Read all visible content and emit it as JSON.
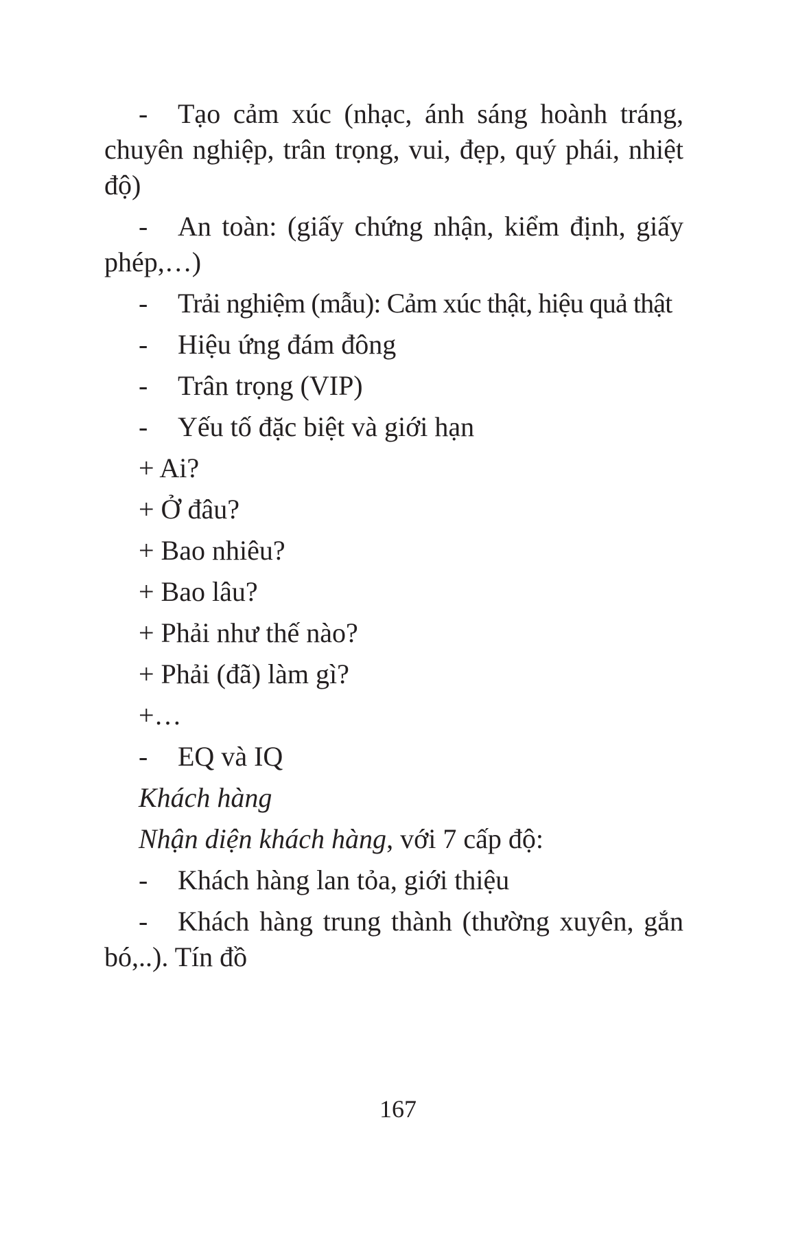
{
  "items": [
    {
      "type": "dash",
      "text": "Tạo cảm xúc (nhạc, ánh sáng hoành tráng, chuyên nghiệp, trân trọng, vui, đẹp, quý phái, nhiệt độ)"
    },
    {
      "type": "dash",
      "text": "An toàn: (giấy chứng nhận, kiểm định, giấy phép,…)"
    },
    {
      "type": "dash",
      "text": "Trải nghiệm (mẫu): Cảm xúc thật, hiệu quả thật"
    },
    {
      "type": "dash",
      "text": "Hiệu ứng đám đông"
    },
    {
      "type": "dash",
      "text": "Trân trọng (VIP)"
    },
    {
      "type": "dash",
      "text": "Yếu tố đặc biệt và giới hạn"
    },
    {
      "type": "plus",
      "text": "+ Ai?"
    },
    {
      "type": "plus",
      "text": "+ Ở đâu?"
    },
    {
      "type": "plus",
      "text": "+ Bao nhiêu?"
    },
    {
      "type": "plus",
      "text": "+ Bao lâu?"
    },
    {
      "type": "plus",
      "text": "+ Phải như thế nào?"
    },
    {
      "type": "plus",
      "text": "+ Phải (đã) làm gì?"
    },
    {
      "type": "plus",
      "text": "+…"
    },
    {
      "type": "dash",
      "text": "EQ và IQ"
    },
    {
      "type": "heading",
      "text": "Khách hàng"
    },
    {
      "type": "mixed",
      "italic": "Nhận diện khách hàng",
      "rest": ", với 7 cấp độ:"
    },
    {
      "type": "dash",
      "text": "Khách hàng lan tỏa, giới thiệu"
    },
    {
      "type": "dash",
      "text": "Khách hàng trung thành (thường xuyên, gắn bó,..). Tín đồ"
    }
  ],
  "dash_symbol": "-",
  "page_number": "167"
}
